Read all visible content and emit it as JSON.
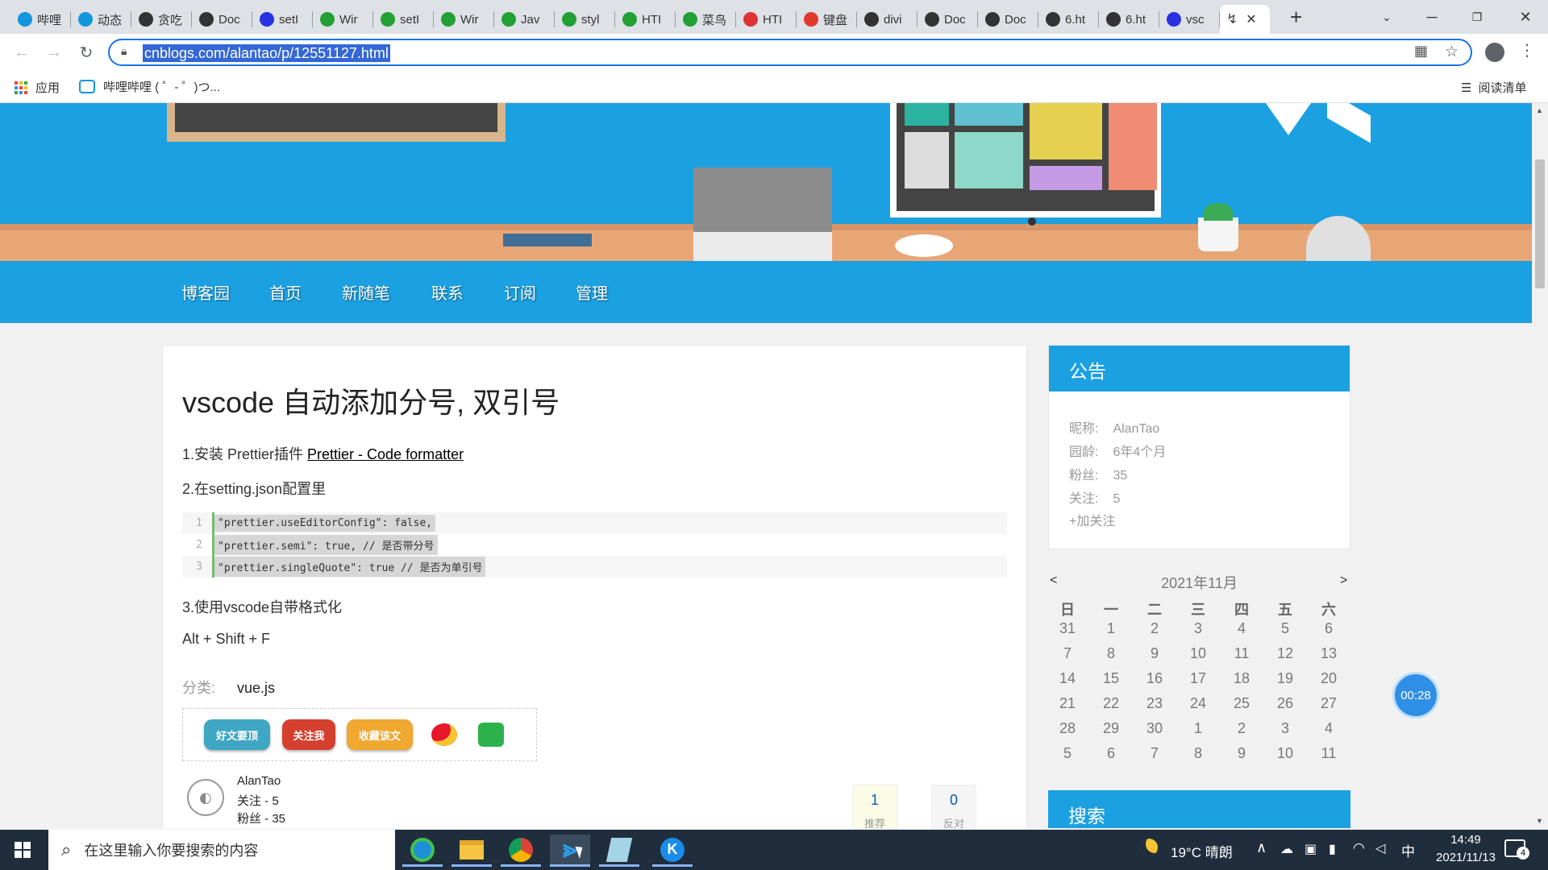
{
  "browser": {
    "tabs": [
      {
        "label": "哔哩",
        "color": "#1296db",
        "glyph": "tv-icon"
      },
      {
        "label": "动态",
        "color": "#1296db",
        "glyph": "tv-icon"
      },
      {
        "label": "贪吃",
        "color": "#333333",
        "glyph": "globe-icon"
      },
      {
        "label": "Doc",
        "color": "#333333",
        "glyph": "globe-icon"
      },
      {
        "label": "setI",
        "color": "#2932e1",
        "glyph": "paw-icon"
      },
      {
        "label": "Wir",
        "color": "#21a134",
        "glyph": "globe-icon"
      },
      {
        "label": "setI",
        "color": "#21a134",
        "glyph": "globe-icon"
      },
      {
        "label": "Wir",
        "color": "#21a134",
        "glyph": "globe-icon"
      },
      {
        "label": "Jav",
        "color": "#21a134",
        "glyph": "globe-icon"
      },
      {
        "label": "styl",
        "color": "#21a134",
        "glyph": "globe-icon"
      },
      {
        "label": "HTI",
        "color": "#21a134",
        "glyph": "globe-icon"
      },
      {
        "label": "菜鸟",
        "color": "#21a134",
        "glyph": "globe-icon"
      },
      {
        "label": "HTI",
        "color": "#d33",
        "glyph": "shield-icon"
      },
      {
        "label": "键盘",
        "color": "#e03a2c",
        "glyph": "c-icon"
      },
      {
        "label": "divi",
        "color": "#333333",
        "glyph": "globe-icon"
      },
      {
        "label": "Doc",
        "color": "#333333",
        "glyph": "globe-icon"
      },
      {
        "label": "Doc",
        "color": "#333333",
        "glyph": "globe-icon"
      },
      {
        "label": "6.ht",
        "color": "#333333",
        "glyph": "globe-icon"
      },
      {
        "label": "6.ht",
        "color": "#333333",
        "glyph": "globe-icon"
      },
      {
        "label": "vsc",
        "color": "#2932e1",
        "glyph": "paw-icon"
      }
    ],
    "new_tab": "+",
    "url": "cnblogs.com/alantao/p/12551127.html",
    "bookmarks": {
      "apps": "应用",
      "bilibili": "哔哩哔哩 ( ゜- ゜)つ...",
      "reading_list": "阅读清单"
    }
  },
  "site": {
    "nav": [
      "博客园",
      "首页",
      "新随笔",
      "联系",
      "订阅",
      "管理"
    ]
  },
  "article": {
    "title": "vscode 自动添加分号, 双引号",
    "step1_prefix": "1.安装 Prettier插件 ",
    "step1_link": "Prettier - Code formatter",
    "step2": "2.在setting.json配置里",
    "code_lines": [
      {
        "n": "1",
        "text": "\"prettier.useEditorConfig\": false,"
      },
      {
        "n": "2",
        "text": "\"prettier.semi\": true,    // 是否带分号"
      },
      {
        "n": "3",
        "text": "\"prettier.singleQuote\": true    // 是否为单引号"
      }
    ],
    "step3": "3.使用vscode自带格式化",
    "shortcut": "Alt + Shift + F",
    "category_label": "分类:",
    "category": "vue.js",
    "share_buttons": [
      "好文要顶",
      "关注我",
      "收藏该文"
    ],
    "share_colors": [
      "#3fa6c3",
      "#d43f2e",
      "#f0a830"
    ],
    "author": {
      "name": "AlanTao",
      "following": "关注 - 5",
      "followers": "粉丝 - 35"
    },
    "digg": {
      "count": "1",
      "label": "推荐"
    },
    "bury": {
      "count": "0",
      "label": "反对"
    }
  },
  "sidebar": {
    "notice_title": "公告",
    "notice": [
      {
        "label": "昵称:",
        "value": "AlanTao"
      },
      {
        "label": "园龄:",
        "value": "6年4个月"
      },
      {
        "label": "粉丝:",
        "value": "35"
      },
      {
        "label": "关注:",
        "value": "5"
      }
    ],
    "follow_link": "+加关注",
    "calendar": {
      "prev": "<",
      "next": ">",
      "month": "2021年11月",
      "weekdays": [
        "日",
        "一",
        "二",
        "三",
        "四",
        "五",
        "六"
      ],
      "days": [
        [
          "31",
          "1",
          "2",
          "3",
          "4",
          "5",
          "6"
        ],
        [
          "7",
          "8",
          "9",
          "10",
          "11",
          "12",
          "13"
        ],
        [
          "14",
          "15",
          "16",
          "17",
          "18",
          "19",
          "20"
        ],
        [
          "21",
          "22",
          "23",
          "24",
          "25",
          "26",
          "27"
        ],
        [
          "28",
          "29",
          "30",
          "1",
          "2",
          "3",
          "4"
        ],
        [
          "5",
          "6",
          "7",
          "8",
          "9",
          "10",
          "11"
        ]
      ]
    },
    "search_title": "搜索"
  },
  "timer_badge": "00:28",
  "taskbar": {
    "search_placeholder": "在这里输入你要搜索的内容",
    "weather": "19°C 晴朗",
    "ime": "中",
    "time": "14:49",
    "date": "2021/11/13",
    "notifications": "4"
  }
}
